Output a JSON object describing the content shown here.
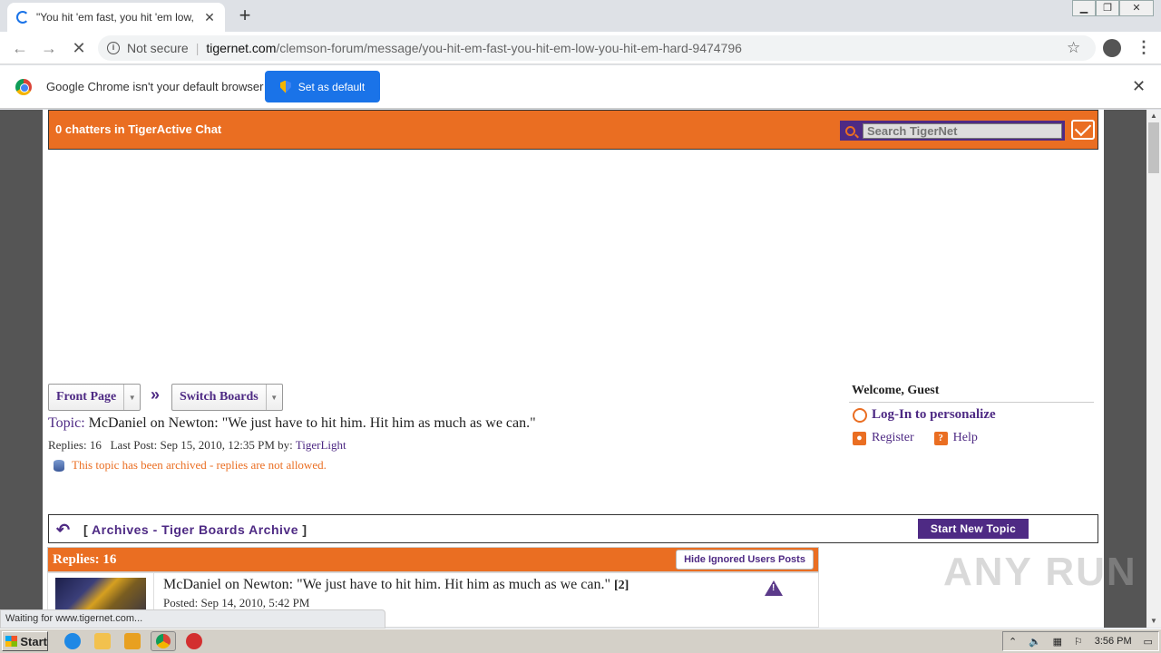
{
  "browser": {
    "tab_title": "\"You hit 'em fast, you hit 'em low, yo",
    "url_security": "Not secure",
    "url_host": "tigernet.com",
    "url_path": "/clemson-forum/message/you-hit-em-fast-you-hit-em-low-you-hit-em-hard-9474796",
    "infobar_text": "Google Chrome isn't your default browser",
    "set_default_label": "Set as default",
    "status_text": "Waiting for www.tigernet.com..."
  },
  "site": {
    "chatters": "0 chatters in TigerActive Chat",
    "search_placeholder": "Search TigerNet"
  },
  "breadcrumb": {
    "front_page": "Front Page",
    "separator": "»",
    "switch_boards": "Switch Boards"
  },
  "topic": {
    "label": "Topic:",
    "title": "McDaniel on Newton: \"We just have to hit him. Hit him as much as we can.\"",
    "replies_text": "Replies: 16   Last Post: Sep 15, 2010, 12:35 PM by:",
    "last_poster": "TigerLight",
    "archived_notice": "This topic has been archived - replies are not allowed."
  },
  "sidebar": {
    "welcome": "Welcome, Guest",
    "login": "Log-In to personalize",
    "register": "Register",
    "help": "Help"
  },
  "archive_bar": {
    "open_bracket": "[",
    "archives": "Archives",
    "dash": "-",
    "board": "Tiger Boards Archive",
    "close_bracket": "]",
    "start_new": "Start New Topic"
  },
  "replies_box": {
    "label": "Replies: 16",
    "hide_ignored": "Hide Ignored Users Posts"
  },
  "post": {
    "title": "McDaniel on Newton: \"We just have to hit him. Hit him as much as we can.\"",
    "count": "[2]",
    "posted": "Posted: Sep 14, 2010, 5:42 PM"
  },
  "watermark": "ANY RUN",
  "taskbar": {
    "start": "Start",
    "clock": "3:56 PM"
  },
  "colors": {
    "orange": "#ea6e22",
    "purple": "#4e2a84",
    "chrome_blue": "#1a73e8"
  }
}
